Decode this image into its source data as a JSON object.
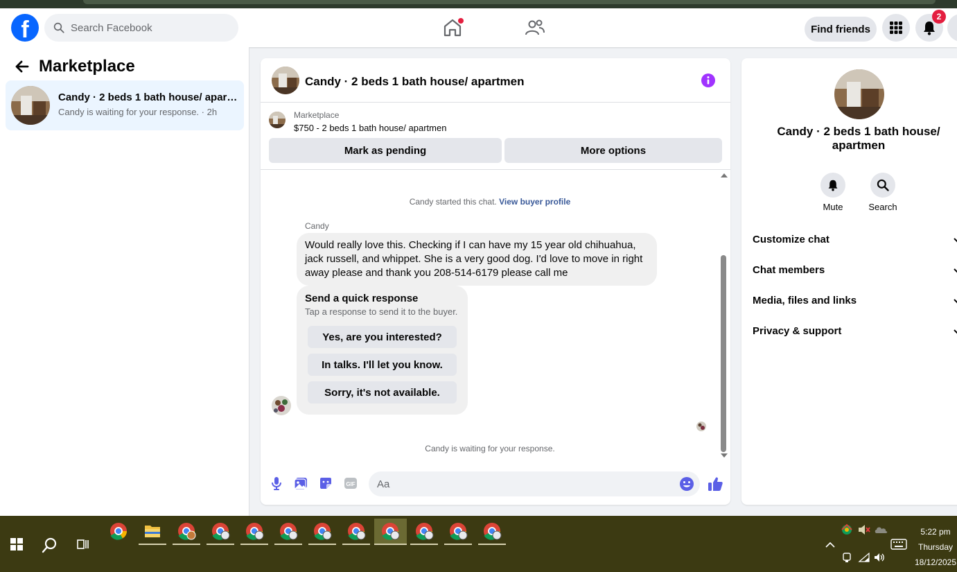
{
  "header": {
    "search_placeholder": "Search Facebook",
    "find_friends_label": "Find friends",
    "notification_count": "2"
  },
  "left_panel": {
    "title": "Marketplace",
    "threads": [
      {
        "title": "Candy · 2 beds 1 bath house/ apart...",
        "subtitle": "Candy is waiting for your response. · 2h"
      }
    ]
  },
  "chat": {
    "header_name": "Candy · 2 beds 1 bath house/ apartmen",
    "listing": {
      "source": "Marketplace",
      "title": "$750 - 2 beds 1 bath house/ apartmen",
      "mark_pending_label": "Mark as pending",
      "more_options_label": "More options"
    },
    "started_text": "Candy started this chat.",
    "view_profile_link": "View buyer profile",
    "sender_name": "Candy",
    "message_text": "Would really love this.   Checking if I can have my 15 year old chihuahua, jack russell, and whippet.  She is a very good dog.  I'd love to move in right away please and thank you 208-514-6179 please call me",
    "quick_response": {
      "title": "Send a quick response",
      "subtitle": "Tap a response to send it to the buyer.",
      "options": [
        "Yes, are you interested?",
        "In talks. I'll let you know.",
        "Sorry, it's not available."
      ]
    },
    "waiting_text": "Candy is waiting for your response.",
    "composer_placeholder": "Aa"
  },
  "right_panel": {
    "name": "Candy · 2 beds 1 bath house/ apartmen",
    "actions": [
      {
        "label": "Mute",
        "icon": "bell-icon"
      },
      {
        "label": "Search",
        "icon": "search-icon"
      }
    ],
    "sections": [
      "Customize chat",
      "Chat members",
      "Media, files and links",
      "Privacy & support"
    ]
  },
  "taskbar": {
    "time": "5:22 pm",
    "day": "Thursday",
    "date": "18/12/2025"
  },
  "colors": {
    "accent": "#0866ff",
    "messenger_purple": "#a033ff",
    "composer_blue": "#5b5fe6",
    "badge_red": "#e41e3f",
    "taskbar": "#3c3a12"
  }
}
